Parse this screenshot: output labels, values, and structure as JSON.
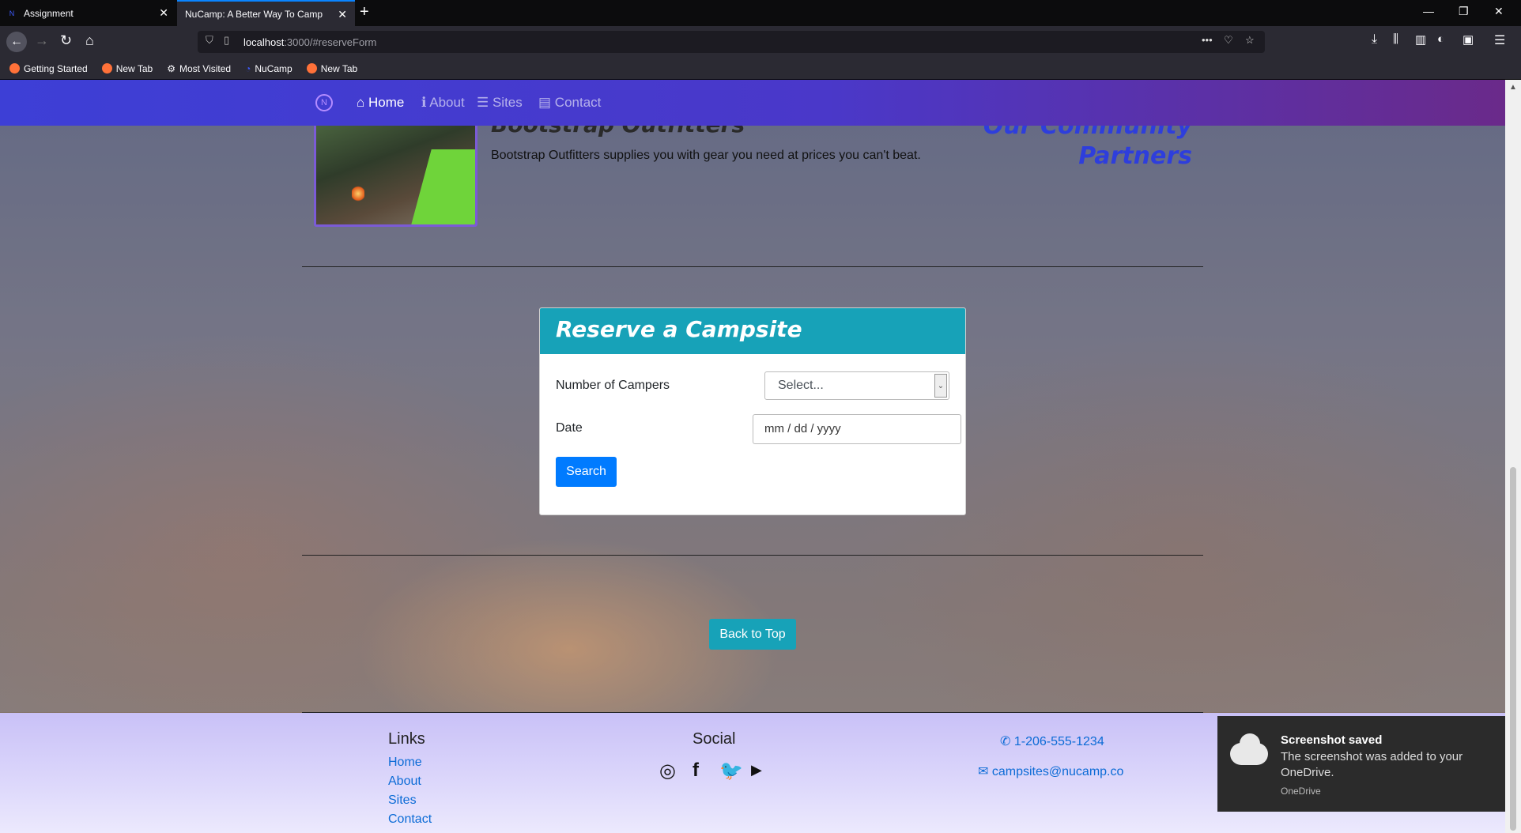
{
  "browser": {
    "tabs": [
      {
        "title": "Assignment",
        "active": false
      },
      {
        "title": "NuCamp: A Better Way To Camp",
        "active": true
      }
    ],
    "url_host": "localhost",
    "url_rest": ":3000/#reserveForm",
    "bookmarks": [
      "Getting Started",
      "New Tab",
      "Most Visited",
      "NuCamp",
      "New Tab"
    ]
  },
  "site_nav": {
    "items": [
      "Home",
      "About",
      "Sites",
      "Contact"
    ],
    "active": "Home"
  },
  "partner": {
    "title": "Bootstrap Outfitters",
    "text": "Bootstrap Outfitters supplies you with gear you need at prices you can't beat.",
    "community_heading": "Our Community Partners"
  },
  "reserve": {
    "heading": "Reserve a Campsite",
    "campers_label": "Number of Campers",
    "campers_value": "Select...",
    "date_label": "Date",
    "date_placeholder": "mm / dd / yyyy",
    "search_label": "Search"
  },
  "back_to_top": "Back to Top",
  "footer": {
    "links_heading": "Links",
    "links": [
      "Home",
      "About",
      "Sites",
      "Contact"
    ],
    "social_heading": "Social",
    "social_icons": [
      "instagram-icon",
      "facebook-icon",
      "twitter-icon",
      "youtube-icon"
    ],
    "phone": "1-206-555-1234",
    "email": "campsites@nucamp.co"
  },
  "toast": {
    "title": "Screenshot saved",
    "message": "The screenshot was added to your OneDrive.",
    "source": "OneDrive"
  },
  "colors": {
    "nav_start": "#3d3fd6",
    "nav_end": "#6a2a8a",
    "card_header": "#17a2b8",
    "primary_button": "#007bff",
    "link": "#0b6bd6"
  }
}
